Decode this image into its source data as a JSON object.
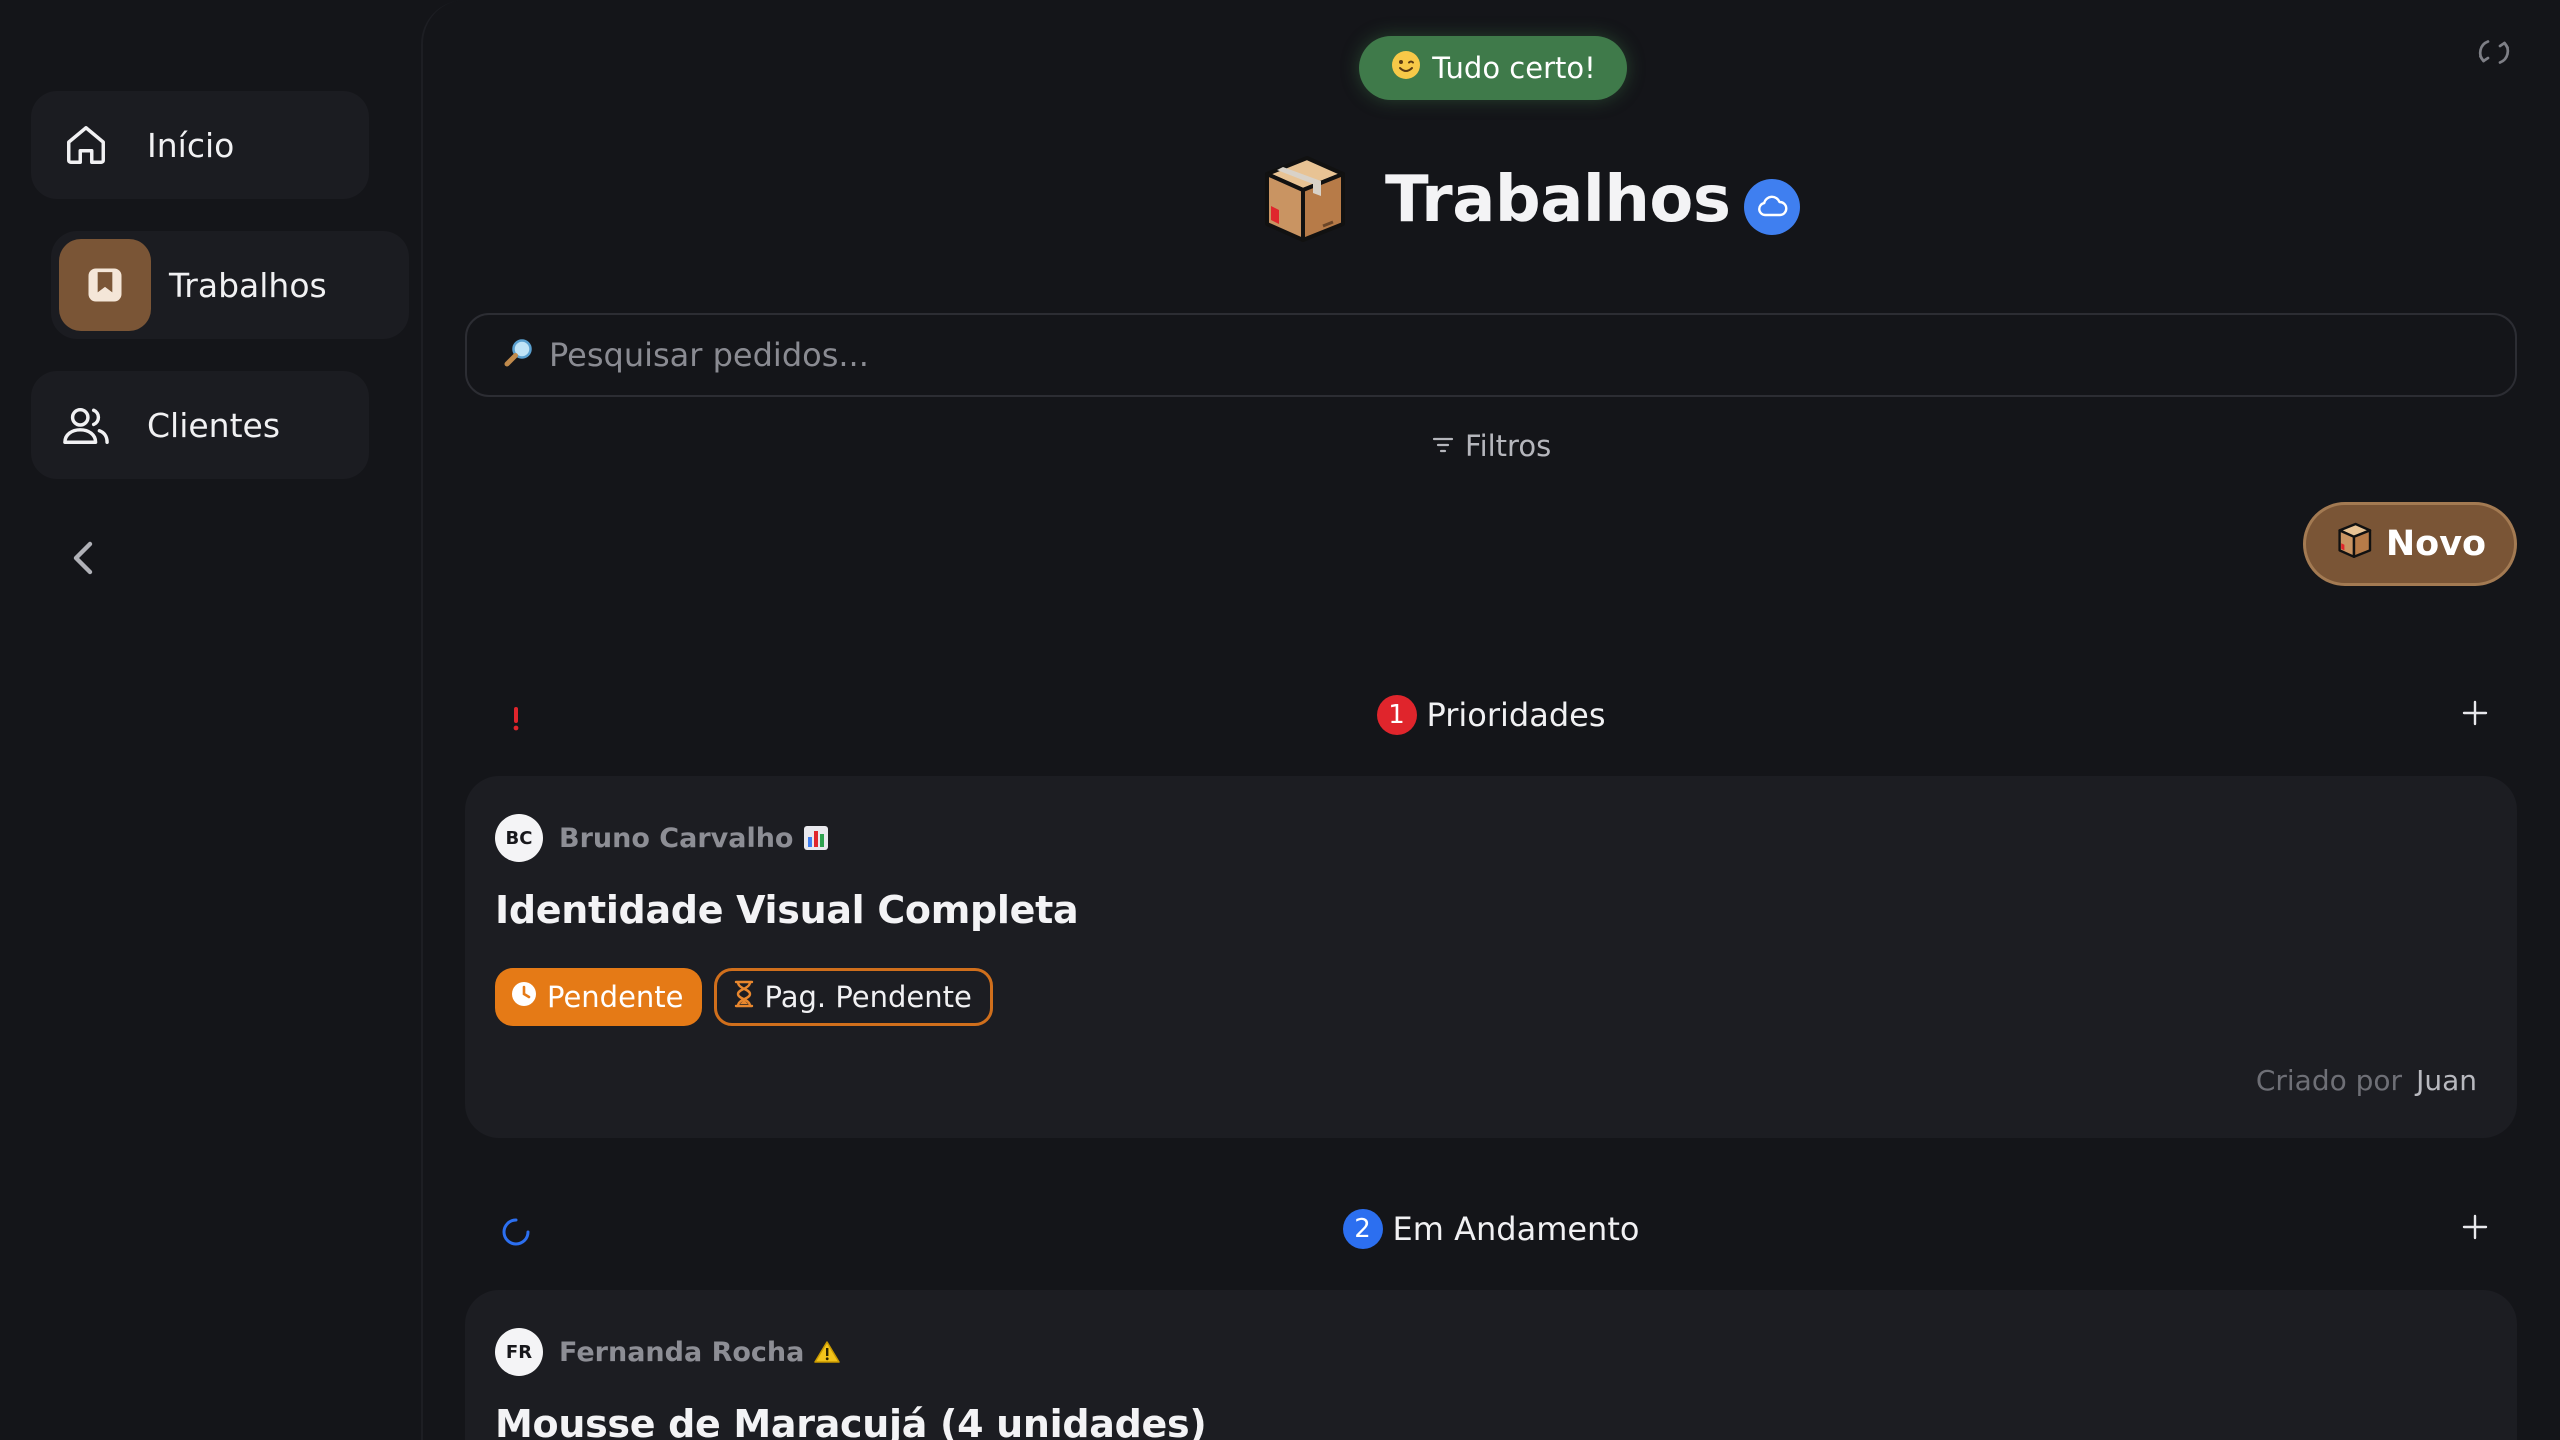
{
  "sidebar": {
    "items": [
      {
        "label": "Início",
        "icon": "home-icon"
      },
      {
        "label": "Trabalhos",
        "icon": "bookmark-box-icon",
        "active": true
      },
      {
        "label": "Clientes",
        "icon": "users-icon"
      }
    ],
    "collapse_icon": "chevron-left-icon"
  },
  "status": {
    "emoji": "smiling-face-icon",
    "label": "Tudo certo!",
    "color": "#3f7a4a"
  },
  "header": {
    "title": "Trabalhos",
    "title_icon": "package-box-icon",
    "sync_icon": "cloud-icon"
  },
  "search": {
    "placeholder": "Pesquisar pedidos...",
    "value": ""
  },
  "filters": {
    "label": "Filtros"
  },
  "new_button": {
    "label": "Novo"
  },
  "sections": [
    {
      "label": "Prioridades",
      "count": "1",
      "icon": "exclamation-icon",
      "badge_color": "#e0252c",
      "cards": [
        {
          "initials": "BC",
          "owner": "Bruno Carvalho",
          "owner_emoji": "bar-chart-icon",
          "title": "Identidade Visual Completa",
          "status_chip": "Pendente",
          "payment_chip": "Pag. Pendente",
          "created_by_label": "Criado por",
          "created_by": "Juan"
        }
      ]
    },
    {
      "label": "Em Andamento",
      "count": "2",
      "icon": "loading-spinner-icon",
      "badge_color": "#2c6ff0",
      "cards": [
        {
          "initials": "FR",
          "owner": "Fernanda Rocha",
          "owner_emoji": "warning-icon",
          "title": "Mousse de Maracujá (4 unidades)"
        }
      ]
    }
  ],
  "colors": {
    "accent_brown": "#7a5536",
    "pending_orange": "#e57a16",
    "background": "#141519",
    "card": "#1c1d22"
  }
}
